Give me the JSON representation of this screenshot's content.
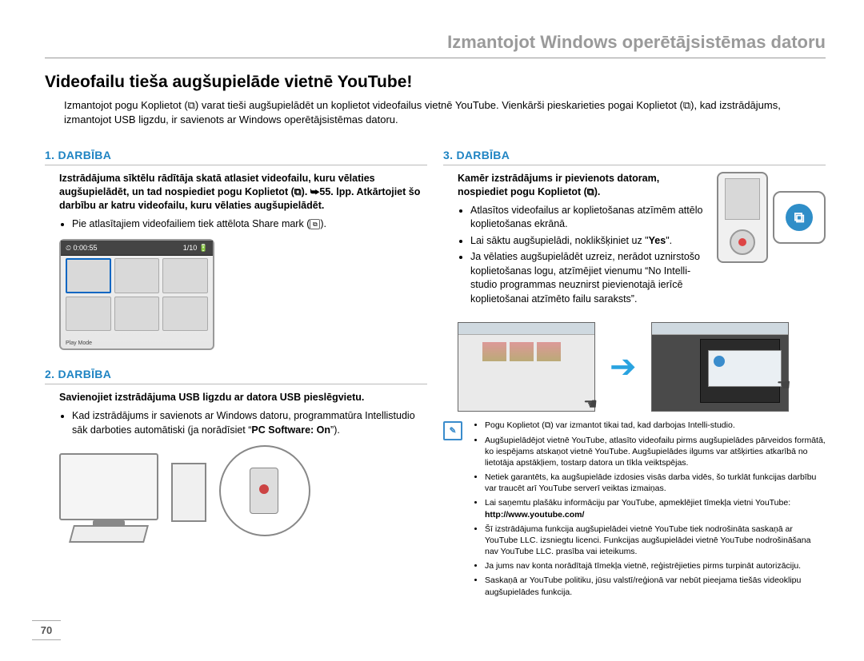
{
  "header": "Izmantojot Windows operētājsistēmas datoru",
  "title": "Videofailu tieša augšupielāde vietnē YouTube!",
  "intro": "Izmantojot pogu Koplietot (⧉) varat tieši augšupielādēt un koplietot videofailus vietnē YouTube. Vienkārši pieskarieties pogai Koplietot (⧉), kad izstrādājums, izmantojot USB ligzdu, ir savienots ar Windows operētājsistēmas datoru.",
  "step1": {
    "head": "1. DARBĪBA",
    "bold": "Izstrādājuma sīktēlu rādītāja skatā atlasiet videofailu, kuru vēlaties augšupielādēt, un tad nospiediet pogu Koplietot (⧉). ➥55. lpp. Atkārtojiet šo darbību ar katru videofailu, kuru vēlaties augšupielādēt.",
    "bullet1": "Pie atlasītajiem videofailiem tiek attēlota Share mark (",
    "bullet1_end": ").",
    "thumb_time": "0:00:55",
    "thumb_count": "1/10",
    "thumb_foot": "Play Mode"
  },
  "step2": {
    "head": "2. DARBĪBA",
    "bold": "Savienojiet izstrādājuma USB ligzdu ar datora USB pieslēgvietu.",
    "bullet_pre": "Kad izstrādājums ir savienots ar Windows datoru, programmatūra Intellistudio sāk darboties automātiski (ja norādīsiet “",
    "pcsoft": "PC Software: On",
    "bullet_post": "”)."
  },
  "step3": {
    "head": "3. DARBĪBA",
    "bold": "Kamēr izstrādājums ir pievienots datoram, nospiediet pogu Koplietot (⧉).",
    "b1": "Atlasītos videofailus ar koplietošanas atzīmēm attēlo koplietošanas ekrānā.",
    "b2a": "Lai sāktu augšupielādi, noklikšķiniet uz \"",
    "b2yes": "Yes",
    "b2b": "\".",
    "b3": "Ja vēlaties augšupielādēt uzreiz, nerādot uznirstošo koplietošanas logu, atzīmējiet vienumu “No Intelli-studio programmas neuznirst pievienotajā ierīcē koplietošanai atzīmēto failu saraksts”."
  },
  "notes": {
    "n1": "Pogu Koplietot (⧉) var izmantot tikai tad, kad darbojas Intelli-studio.",
    "n2": "Augšupielādējot vietnē YouTube, atlasīto videofailu pirms augšupielādes pārveidos formātā, ko iespējams atskaņot vietnē YouTube. Augšupielādes ilgums var atšķirties atkarībā no lietotāja apstākļiem, tostarp datora un tīkla veiktspējas.",
    "n3": "Netiek garantēts, ka augšupielāde izdosies visās darba vidēs, šo turklāt funkcijas darbību var traucēt arī YouTube serverī veiktas izmaiņas.",
    "n4": "Lai saņemtu plašāku informāciju par YouTube, apmeklējiet tīmekļa vietni YouTube:",
    "n4url": "http://www.youtube.com/",
    "n5": "Šī izstrādājuma funkcija augšupielādei vietnē YouTube tiek nodrošināta saskaņā ar YouTube LLC. izsniegtu licenci. Funkcijas augšupielādei vietnē YouTube nodrošināšana nav YouTube LLC. prasība vai ieteikums.",
    "n6": "Ja jums nav konta norādītajā tīmekļa vietnē, reģistrējieties pirms turpināt autorizāciju.",
    "n7": "Saskaņā ar YouTube politiku, jūsu valstī/reģionā var nebūt pieejama tiešās videoklipu augšupielādes funkcija."
  },
  "pagenum": "70",
  "icons": {
    "share_glyph": "⧉",
    "arrow_glyph": "➔",
    "btn_glyph": "⧉"
  }
}
